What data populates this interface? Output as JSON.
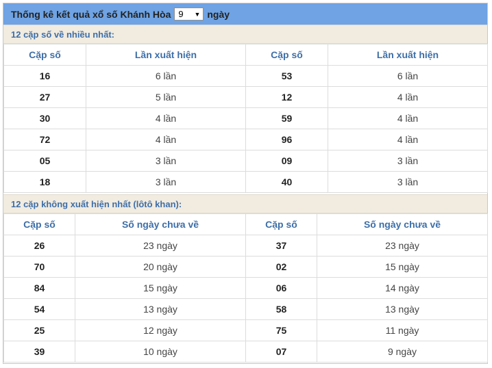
{
  "header": {
    "title_prefix": "Thống kê kết quả xổ số Khánh Hòa",
    "days_selected": "9",
    "title_suffix": "ngày"
  },
  "colors": {
    "header_bar": "#6fa3e3",
    "section_bg": "#f1ebe0",
    "accent_text": "#3d6ea8"
  },
  "section1": {
    "title": "12 cặp số về nhiều nhất:",
    "columns": [
      "Cặp số",
      "Lần xuất hiện",
      "Cặp số",
      "Lần xuất hiện"
    ],
    "rows": [
      [
        "16",
        "6 lần",
        "53",
        "6 lần"
      ],
      [
        "27",
        "5 lần",
        "12",
        "4 lần"
      ],
      [
        "30",
        "4 lần",
        "59",
        "4 lần"
      ],
      [
        "72",
        "4 lần",
        "96",
        "4 lần"
      ],
      [
        "05",
        "3 lần",
        "09",
        "3 lần"
      ],
      [
        "18",
        "3 lần",
        "40",
        "3 lần"
      ]
    ]
  },
  "section2": {
    "title": "12 cặp không xuất hiện nhất (lôtô khan):",
    "columns": [
      "Cặp số",
      "Số ngày chưa về",
      "Cặp số",
      "Số ngày chưa về"
    ],
    "rows": [
      [
        "26",
        "23 ngày",
        "37",
        "23 ngày"
      ],
      [
        "70",
        "20 ngày",
        "02",
        "15 ngày"
      ],
      [
        "84",
        "15 ngày",
        "06",
        "14 ngày"
      ],
      [
        "54",
        "13 ngày",
        "58",
        "13 ngày"
      ],
      [
        "25",
        "12 ngày",
        "75",
        "11 ngày"
      ],
      [
        "39",
        "10 ngày",
        "07",
        "9 ngày"
      ]
    ]
  }
}
